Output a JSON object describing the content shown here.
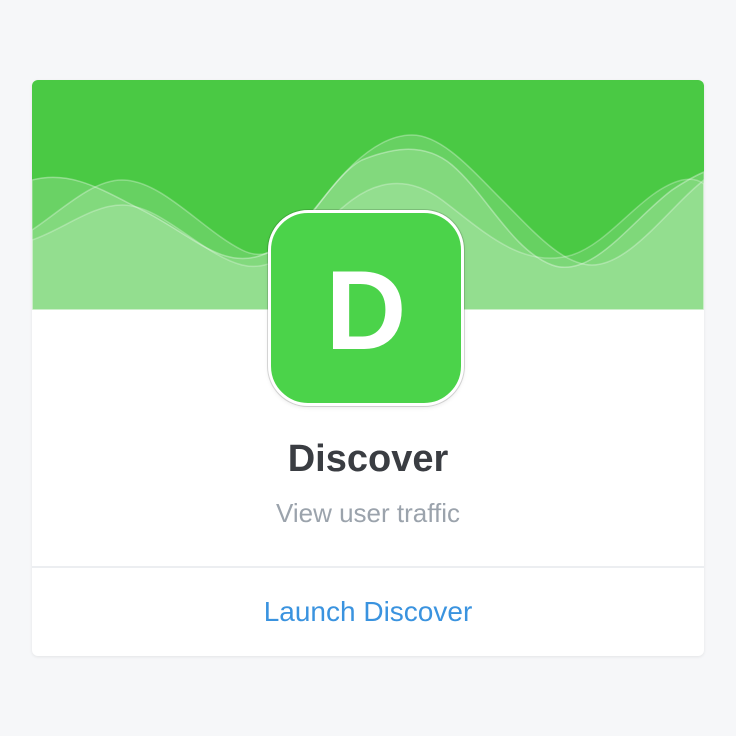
{
  "card": {
    "app_letter": "D",
    "app_name": "Discover",
    "description": "View user traffic",
    "launch_label": "Launch Discover"
  },
  "icons": {
    "app_icon": "discover-app-icon",
    "banner": "wave-chart-decoration"
  },
  "colors": {
    "banner": "#4ac944",
    "app_icon": "#4bd34a",
    "title": "#3a3d42",
    "subtitle": "#9ba3ac",
    "link": "#3a93df",
    "page_background": "#f6f7f9"
  }
}
